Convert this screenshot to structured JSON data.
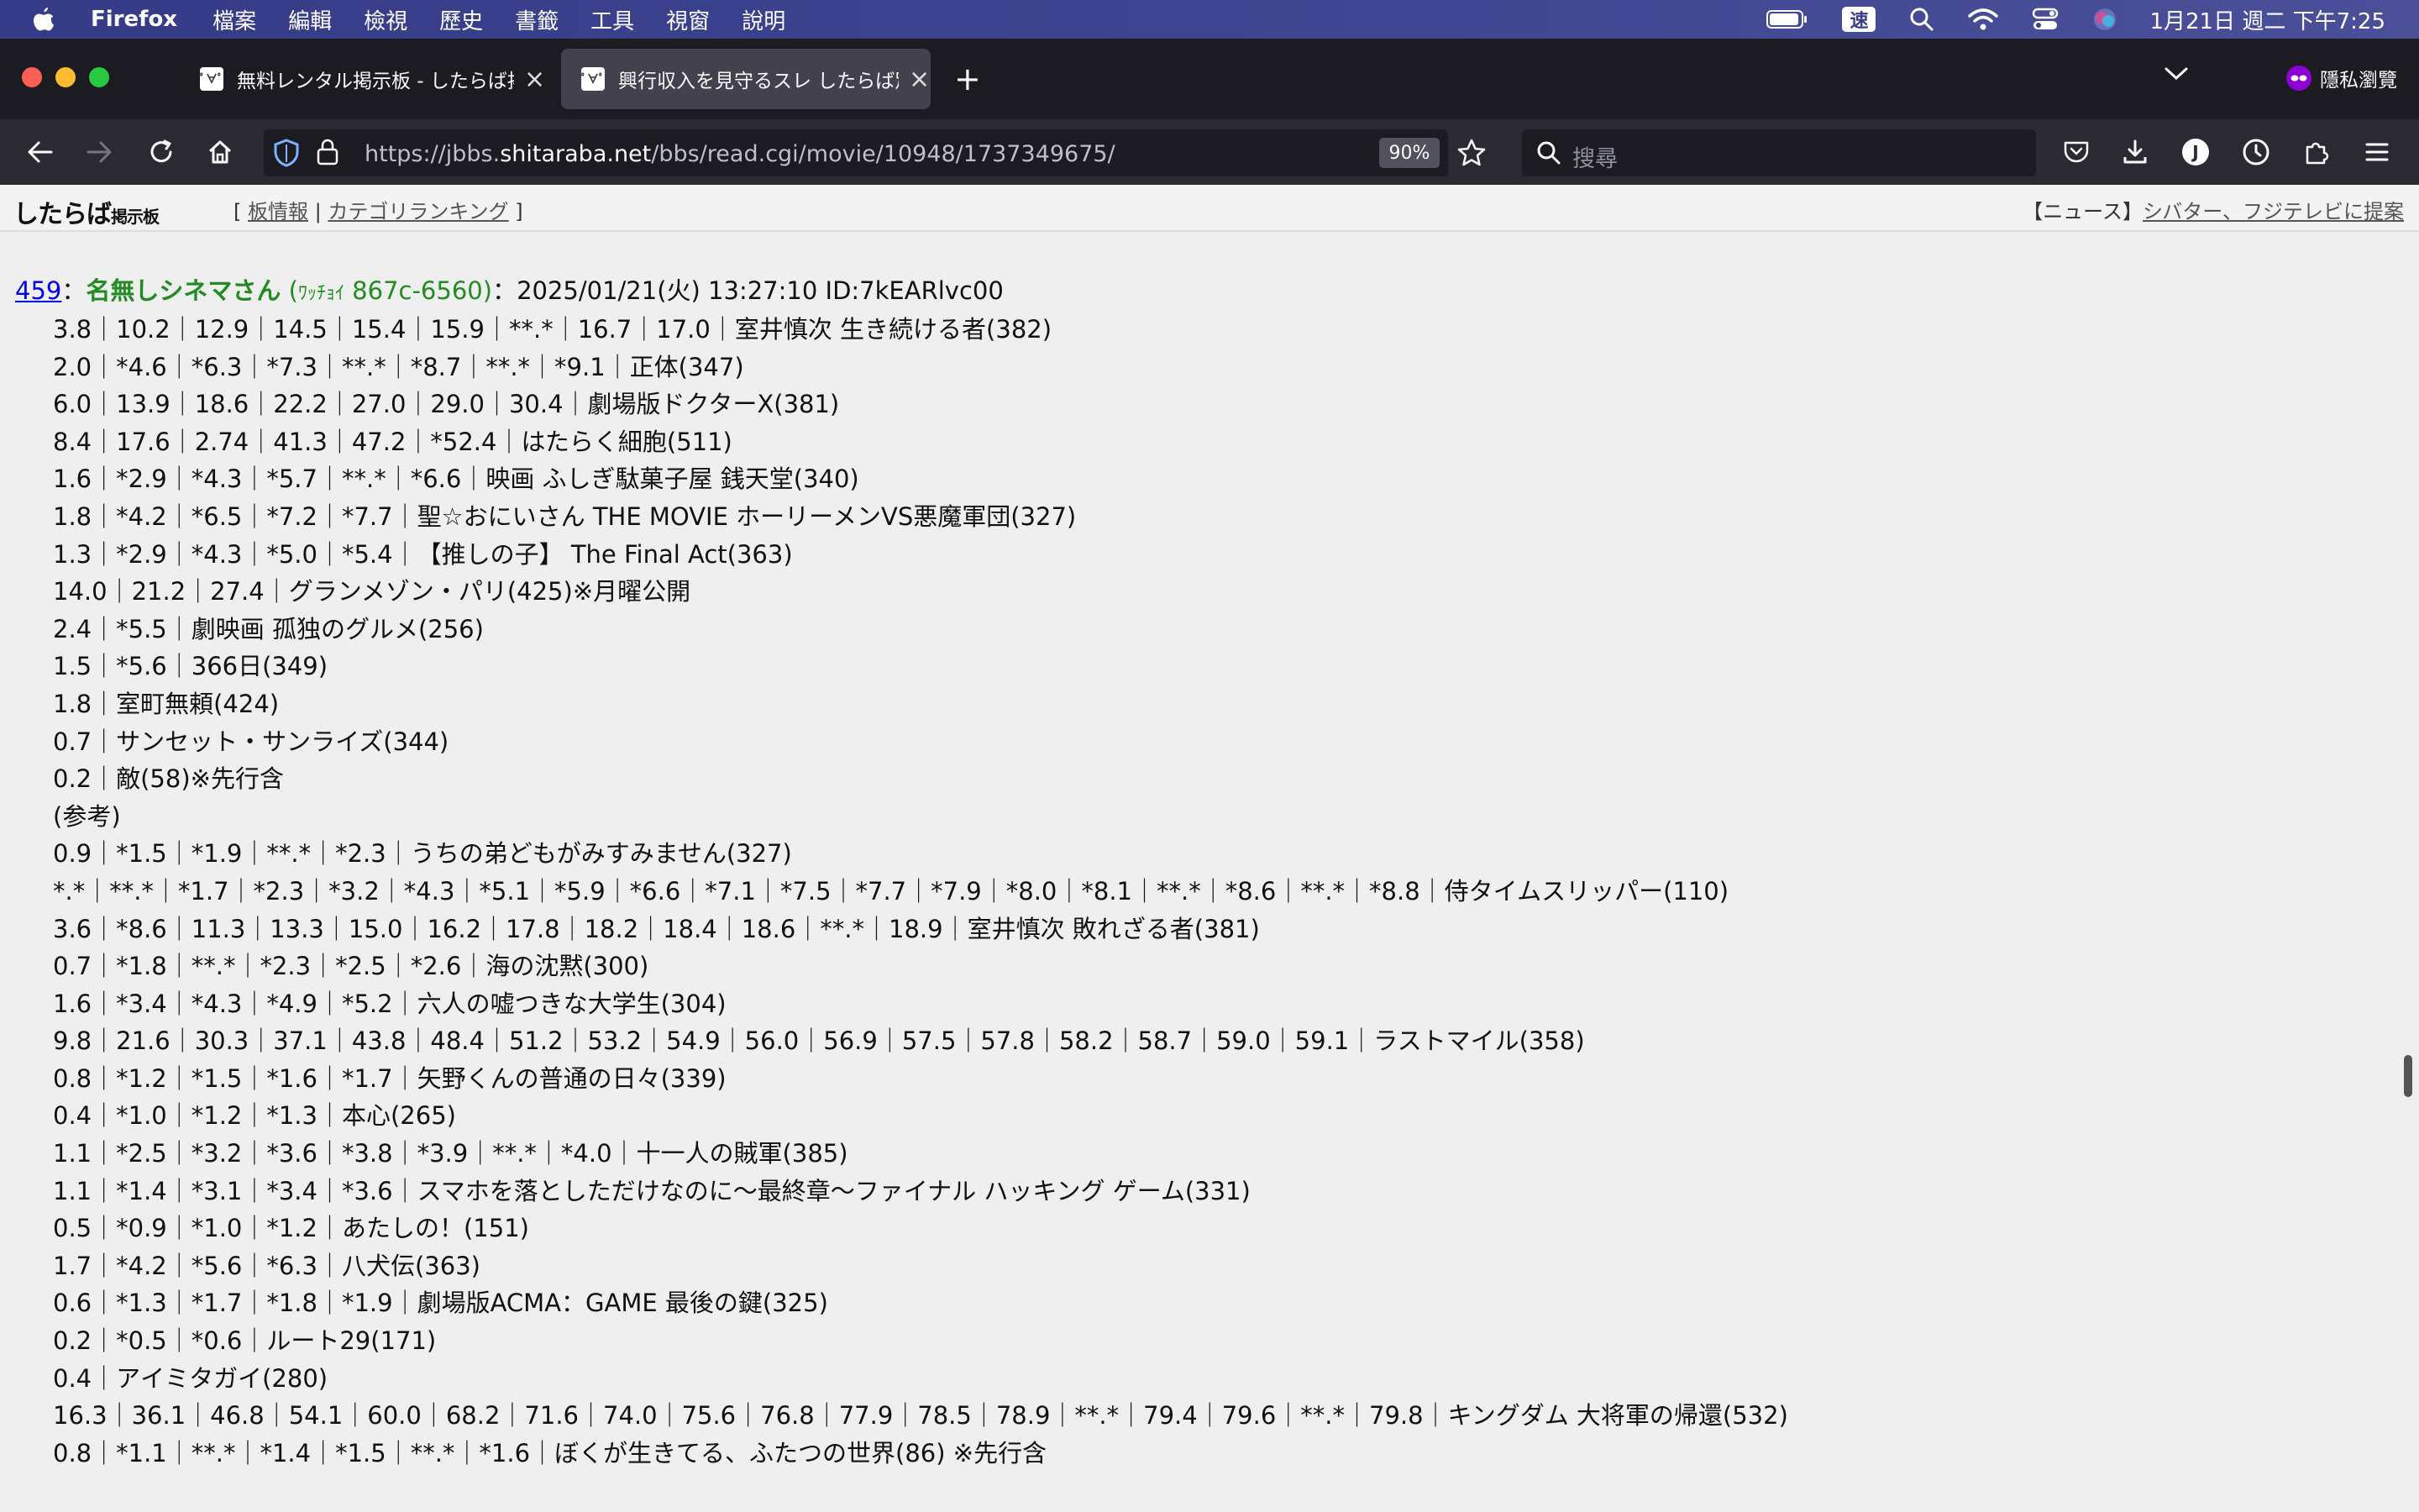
{
  "menubar": {
    "app": "Firefox",
    "items": [
      "檔案",
      "編輯",
      "檢視",
      "歷史",
      "書籤",
      "工具",
      "視窗",
      "說明"
    ],
    "speed_badge": "速",
    "clock": "1月21日 週二 下午7:25"
  },
  "tabs": [
    {
      "title": "無料レンタル掲示板 - したらば掲示板",
      "active": false
    },
    {
      "title": "興行収入を見守るスレ したらば別館",
      "active": true
    }
  ],
  "private_label": "隱私瀏覽",
  "navbar": {
    "url_prefix": "https://jbbs.",
    "url_domain": "shitaraba.net",
    "url_path": "/bbs/read.cgi/movie/10948/1737349675/",
    "zoom": "90%",
    "search_placeholder": "搜尋"
  },
  "site": {
    "logo_main": "したらば",
    "logo_sub": "掲示板",
    "nav_open": "[ ",
    "nav_board": "板情報",
    "nav_sep": " | ",
    "nav_ranking": "カテゴリランキング",
    "nav_close": " ]",
    "news_label": "【ニュース】",
    "news_link": "シバター、フジテレビに提案"
  },
  "post": {
    "number": "459",
    "colon": "：",
    "name": "名無しシネマさん",
    "trip_open": "(",
    "trip_small": "ﾜｯﾁｮｲ",
    "trip_id": " 867c-6560)",
    "meta": "：2025/01/21(火) 13:27:10 ID:7kEARlvc00",
    "lines": [
      "3.8｜10.2｜12.9｜14.5｜15.4｜15.9｜**.*｜16.7｜17.0｜室井慎次 生き続ける者(382)",
      "2.0｜*4.6｜*6.3｜*7.3｜**.*｜*8.7｜**.*｜*9.1｜正体(347)",
      "6.0｜13.9｜18.6｜22.2｜27.0｜29.0｜30.4｜劇場版ドクターX(381)",
      "8.4｜17.6｜2.74｜41.3｜47.2｜*52.4｜はたらく細胞(511)",
      "1.6｜*2.9｜*4.3｜*5.7｜**.*｜*6.6｜映画 ふしぎ駄菓子屋 銭天堂(340)",
      "1.8｜*4.2｜*6.5｜*7.2｜*7.7｜聖☆おにいさん THE MOVIE ホーリーメンVS悪魔軍団(327)",
      "1.3｜*2.9｜*4.3｜*5.0｜*5.4｜【推しの子】 The Final Act(363)",
      "14.0｜21.2｜27.4｜グランメゾン・パリ(425)※月曜公開",
      "2.4｜*5.5｜劇映画 孤独のグルメ(256)",
      "1.5｜*5.6｜366日(349)",
      "1.8｜室町無頼(424)",
      "0.7｜サンセット・サンライズ(344)",
      "0.2｜敵(58)※先行含",
      "(参考)",
      "0.9｜*1.5｜*1.9｜**.*｜*2.3｜うちの弟どもがみすみません(327)",
      "*.*｜**.*｜*1.7｜*2.3｜*3.2｜*4.3｜*5.1｜*5.9｜*6.6｜*7.1｜*7.5｜*7.7｜*7.9｜*8.0｜*8.1｜**.*｜*8.6｜**.*｜*8.8｜侍タイムスリッパー(110)",
      "3.6｜*8.6｜11.3｜13.3｜15.0｜16.2｜17.8｜18.2｜18.4｜18.6｜**.*｜18.9｜室井慎次 敗れざる者(381)",
      "0.7｜*1.8｜**.*｜*2.3｜*2.5｜*2.6｜海の沈黙(300)",
      "1.6｜*3.4｜*4.3｜*4.9｜*5.2｜六人の嘘つきな大学生(304)",
      "9.8｜21.6｜30.3｜37.1｜43.8｜48.4｜51.2｜53.2｜54.9｜56.0｜56.9｜57.5｜57.8｜58.2｜58.7｜59.0｜59.1｜ラストマイル(358)",
      "0.8｜*1.2｜*1.5｜*1.6｜*1.7｜矢野くんの普通の日々(339)",
      "0.4｜*1.0｜*1.2｜*1.3｜本心(265)",
      "1.1｜*2.5｜*3.2｜*3.6｜*3.8｜*3.9｜**.*｜*4.0｜十一人の賊軍(385)",
      "1.1｜*1.4｜*3.1｜*3.4｜*3.6｜スマホを落としただけなのに〜最終章〜ファイナル ハッキング ゲーム(331)",
      "0.5｜*0.9｜*1.0｜*1.2｜あたしの！(151)",
      "1.7｜*4.2｜*5.6｜*6.3｜八犬伝(363)",
      "0.6｜*1.3｜*1.7｜*1.8｜*1.9｜劇場版ACMA：GAME 最後の鍵(325)",
      "0.2｜*0.5｜*0.6｜ルート29(171)",
      "0.4｜アイミタガイ(280)",
      "16.3｜36.1｜46.8｜54.1｜60.0｜68.2｜71.6｜74.0｜75.6｜76.8｜77.9｜78.5｜78.9｜**.*｜79.4｜79.6｜**.*｜79.8｜キングダム 大将軍の帰還(532)",
      "0.8｜*1.1｜**.*｜*1.4｜*1.5｜**.*｜*1.6｜ぼくが生きてる、ふたつの世界(86) ※先行含"
    ]
  }
}
